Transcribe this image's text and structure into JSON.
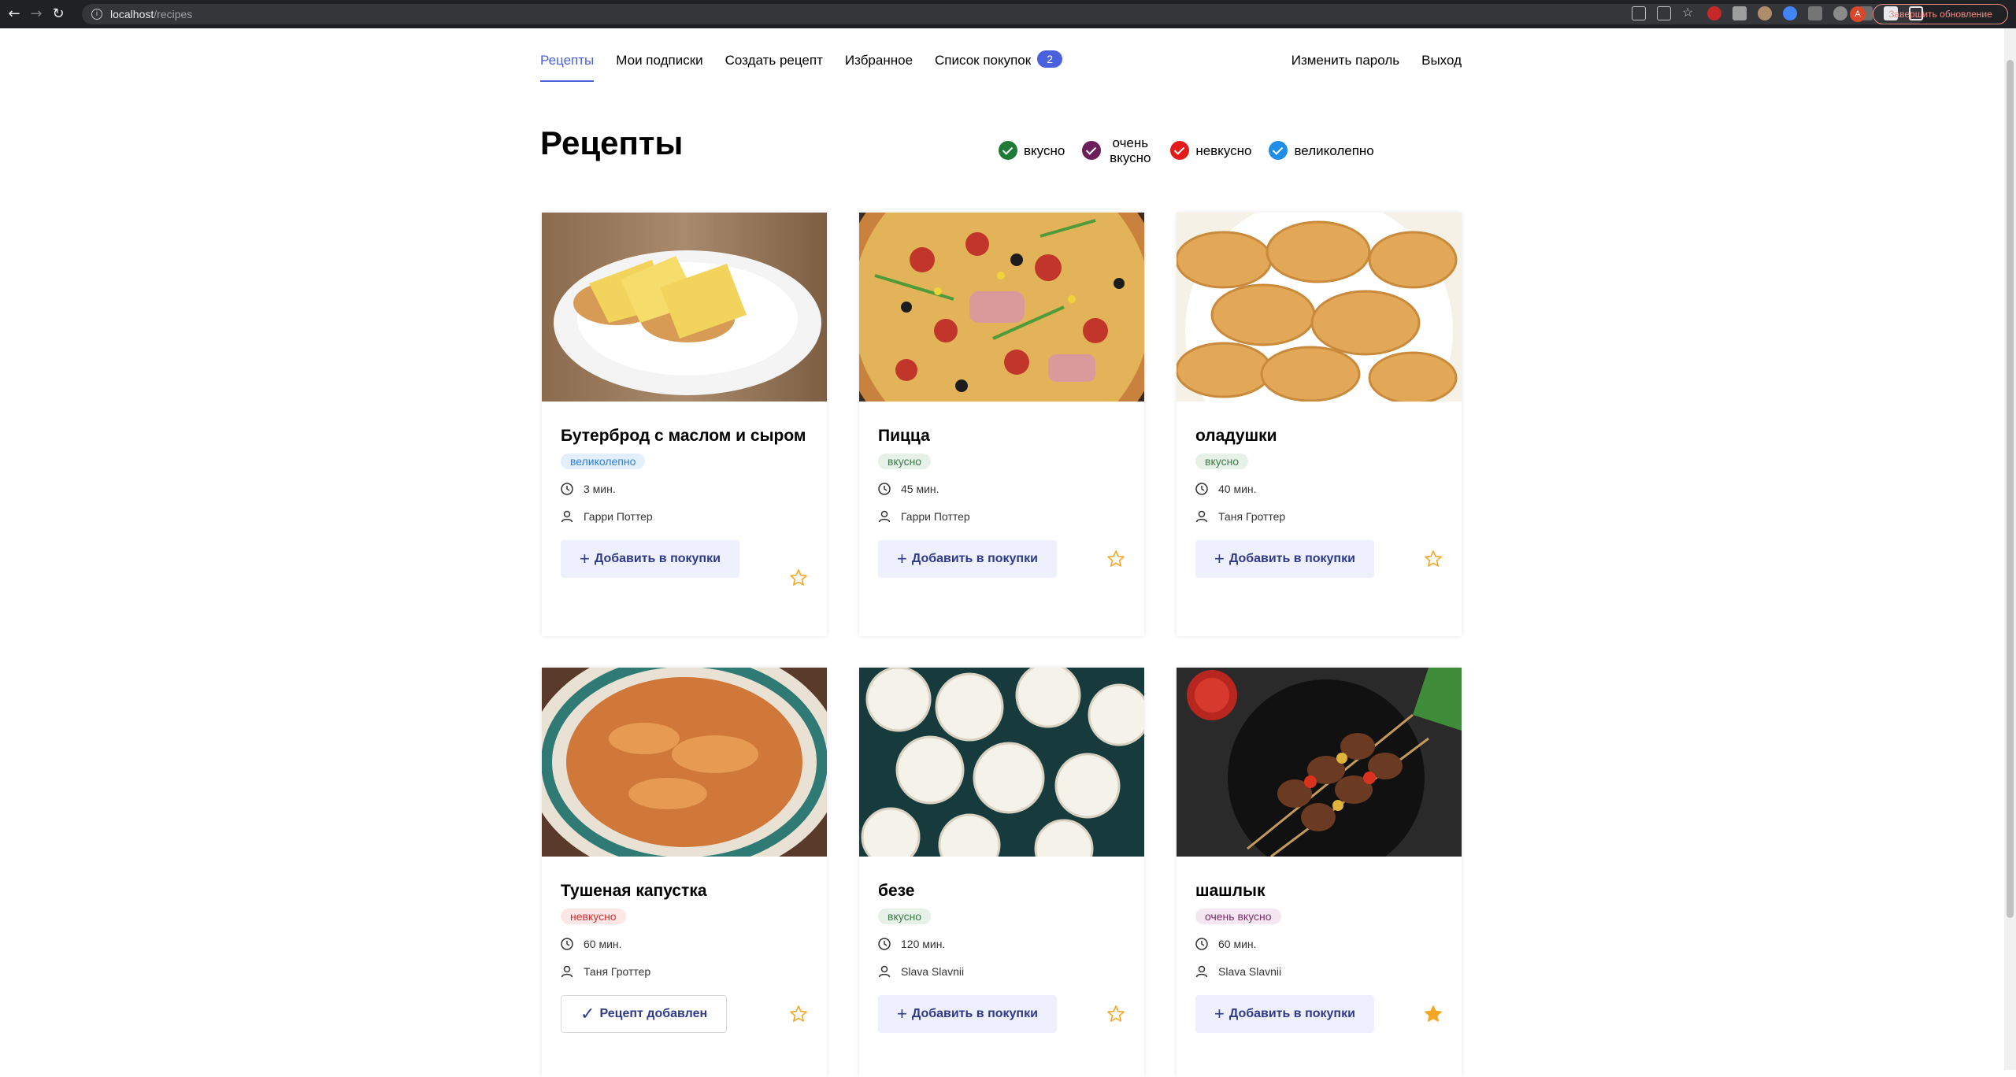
{
  "browser": {
    "url_host": "localhost",
    "url_path": "/recipes",
    "update_button": "Завершить обновление",
    "profile_initial": "A"
  },
  "nav": {
    "items": [
      "Рецепты",
      "Мои подписки",
      "Создать рецепт",
      "Избранное",
      "Список покупок"
    ],
    "cart_count": "2",
    "change_password": "Изменить пароль",
    "logout": "Выход"
  },
  "page": {
    "title": "Рецепты"
  },
  "legend": [
    {
      "label": "вкусно",
      "color": "#1e7a35"
    },
    {
      "label": "очень вкусно",
      "color": "#6c1f5a"
    },
    {
      "label": "невкусно",
      "color": "#e41b1b"
    },
    {
      "label": "великолепно",
      "color": "#1e8ee8"
    }
  ],
  "recipes": [
    {
      "title": "Бутерброд с маслом и сыром",
      "tag": "великолепно",
      "time": "3 мин.",
      "author": "Гарри Поттер",
      "button": "Добавить в покупки",
      "added": false,
      "favorite": false
    },
    {
      "title": "Пицца",
      "tag": "вкусно",
      "time": "45 мин.",
      "author": "Гарри Поттер",
      "button": "Добавить в покупки",
      "added": false,
      "favorite": false
    },
    {
      "title": "оладушки",
      "tag": "вкусно",
      "time": "40 мин.",
      "author": "Таня Гроттер",
      "button": "Добавить в покупки",
      "added": false,
      "favorite": false
    },
    {
      "title": "Тушеная капустка",
      "tag": "невкусно",
      "time": "60 мин.",
      "author": "Таня Гроттер",
      "button": "Рецепт добавлен",
      "added": true,
      "favorite": false
    },
    {
      "title": "безе",
      "tag": "вкусно",
      "time": "120 мин.",
      "author": "Slava Slavnii",
      "button": "Добавить в покупки",
      "added": false,
      "favorite": false
    },
    {
      "title": "шашлык",
      "tag": "очень вкусно",
      "time": "60 мин.",
      "author": "Slava Slavnii",
      "button": "Добавить в покупки",
      "added": false,
      "favorite": true
    }
  ],
  "tag_styles": {
    "великолепно": {
      "bg": "#e3effd",
      "fg": "#2d7fd6"
    },
    "вкусно": {
      "bg": "#e6f1e8",
      "fg": "#3d7a48"
    },
    "невкусно": {
      "bg": "#fde6e6",
      "fg": "#d43030"
    },
    "очень вкусно": {
      "bg": "#f4e7f1",
      "fg": "#7a2f68"
    }
  },
  "colors": {
    "accent": "#4a61dd",
    "star": "#f5a623"
  }
}
